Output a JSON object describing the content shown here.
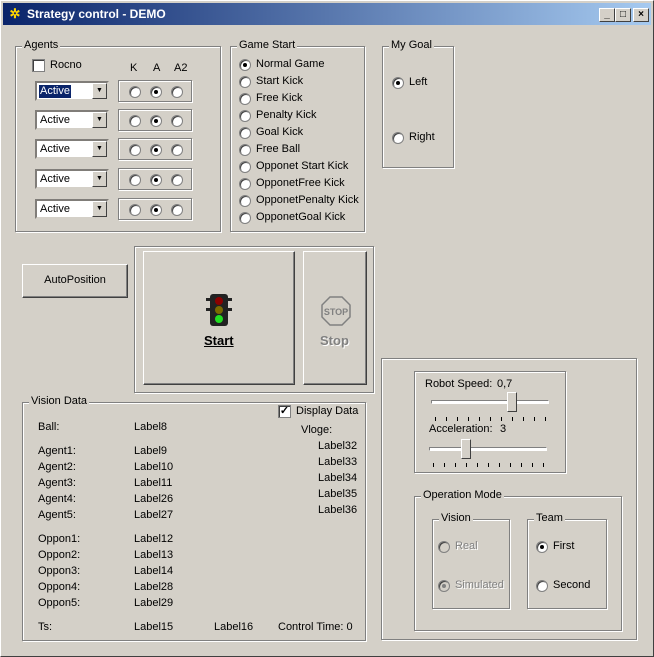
{
  "window": {
    "title": "Strategy control - DEMO",
    "min_label": "_",
    "max_label": "□",
    "close_label": "×"
  },
  "agents": {
    "title": "Agents",
    "rocno_label": "Rocno",
    "headers": [
      "K",
      "A",
      "A2"
    ],
    "rows": [
      {
        "state": "Active",
        "selected_index": 1
      },
      {
        "state": "Active",
        "selected_index": 1
      },
      {
        "state": "Active",
        "selected_index": 1
      },
      {
        "state": "Active",
        "selected_index": 1
      },
      {
        "state": "Active",
        "selected_index": 1
      }
    ]
  },
  "game_start": {
    "title": "Game Start",
    "options": [
      "Normal Game",
      "Start Kick",
      "Free Kick",
      "Penalty Kick",
      "Goal Kick",
      "Free Ball",
      "Opponet Start Kick",
      "OpponetFree Kick",
      "OpponetPenalty Kick",
      "OpponetGoal Kick"
    ],
    "selected": "Normal Game"
  },
  "my_goal": {
    "title": "My Goal",
    "left": "Left",
    "right": "Right",
    "selected": "Left"
  },
  "buttons": {
    "autoposition": "AutoPosition",
    "start": "Start",
    "stop": "Stop",
    "stop_sign": "STOP"
  },
  "vision_data": {
    "title": "Vision Data",
    "display_label": "Display Data",
    "display_checked": true,
    "ball_label": "Ball:",
    "ball_value": "Label8",
    "agents": [
      {
        "label": "Agent1:",
        "value": "Label9"
      },
      {
        "label": "Agent2:",
        "value": "Label10"
      },
      {
        "label": "Agent3:",
        "value": "Label11"
      },
      {
        "label": "Agent4:",
        "value": "Label26"
      },
      {
        "label": "Agent5:",
        "value": "Label27"
      }
    ],
    "opponents": [
      {
        "label": "Oppon1:",
        "value": "Label12"
      },
      {
        "label": "Oppon2:",
        "value": "Label13"
      },
      {
        "label": "Oppon3:",
        "value": "Label14"
      },
      {
        "label": "Oppon4:",
        "value": "Label28"
      },
      {
        "label": "Oppon5:",
        "value": "Label29"
      }
    ],
    "vloge_label": "Vloge:",
    "vloge": [
      "Label32",
      "Label33",
      "Label34",
      "Label35",
      "Label36"
    ],
    "ts_label": "Ts:",
    "ts_value": "Label15",
    "ts_extra": "Label16",
    "control_time": "Control Time: 0"
  },
  "robot": {
    "speed_label": "Robot Speed:",
    "speed_value": "0,7",
    "accel_label": "Acceleration:",
    "accel_value": "3",
    "speed_position": 0.7,
    "accel_position": 0.3
  },
  "operation_mode": {
    "title": "Operation Mode",
    "vision": {
      "title": "Vision",
      "real": "Real",
      "simulated": "Simulated",
      "selected": "Simulated",
      "enabled": false
    },
    "team": {
      "title": "Team",
      "first": "First",
      "second": "Second",
      "selected": "First"
    }
  }
}
